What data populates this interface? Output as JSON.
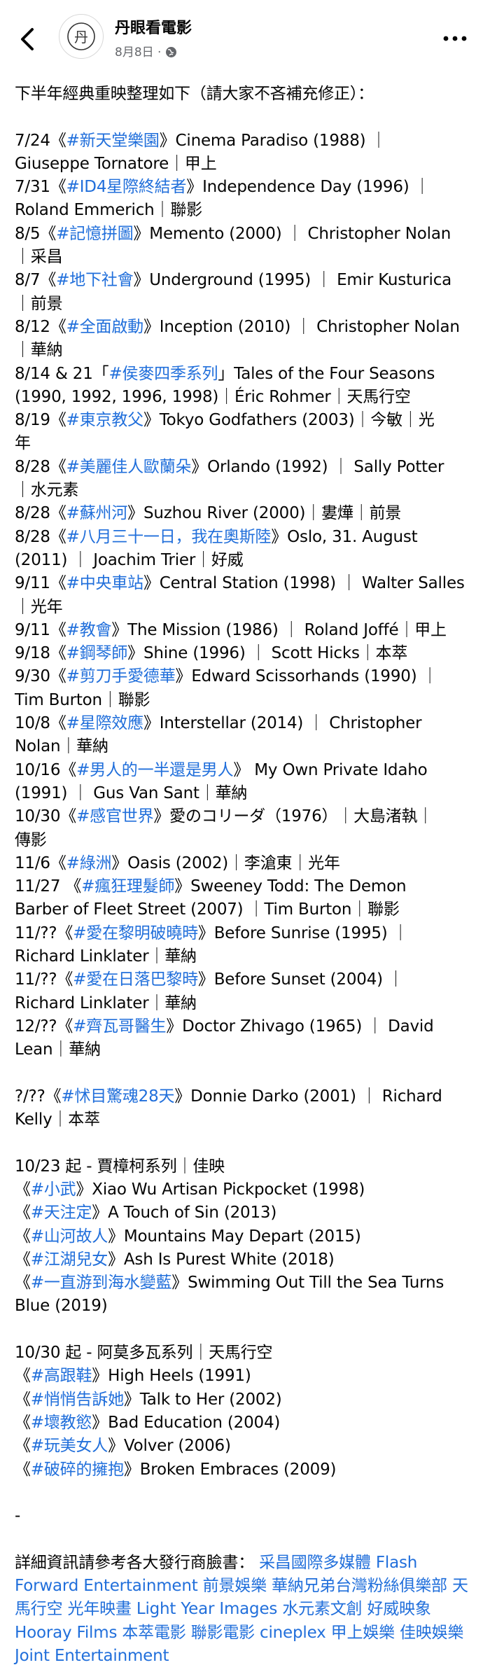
{
  "header": {
    "page_name": "丹眼看電影",
    "avatar_glyph": "丹",
    "date": "8月8日",
    "separator": "·"
  },
  "post": {
    "intro": "下半年經典重映整理如下（請大家不吝補充修正）：",
    "line_1": "7/24《",
    "tag_1": "#新天堂樂園",
    "line_2": "》Cinema Paradiso (1988) ｜\nGiuseppe Tornatore｜甲上\n7/31《",
    "tag_2": "#ID4星際終結者",
    "line_3": "》Independence Day (1996) ｜\nRoland Emmerich｜聯影\n8/5《",
    "tag_3": "#記憶拼圖",
    "line_4": "》Memento (2000) ｜ Christopher Nolan\n｜采昌\n8/7《",
    "tag_4": "#地下社會",
    "line_5": "》Underground (1995) ｜ Emir Kusturica\n｜前景\n8/12《",
    "tag_5": "#全面啟動",
    "line_6": "》Inception (2010) ｜ Christopher Nolan\n｜華納\n8/14 & 21「",
    "tag_6": "#侯麥四季系列",
    "line_7": "」Tales of the Four Seasons\n(1990, 1992, 1996, 1998)｜Éric Rohmer｜天馬行空\n8/19《",
    "tag_7": "#東京教父",
    "line_8": "》Tokyo Godfathers (2003)｜今敏｜光\n年\n8/28《",
    "tag_8": "#美麗佳人歐蘭朵",
    "line_9": "》Orlando (1992) ｜ Sally Potter\n｜水元素\n8/28《",
    "tag_9": "#蘇州河",
    "line_10": "》Suzhou River (2000)｜婁燁｜前景\n8/28《",
    "tag_10": "#八月三十一日，我在奧斯陸",
    "line_11": "》Oslo, 31. August\n(2011) ｜ Joachim Trier｜好威\n9/11《",
    "tag_11": "#中央車站",
    "line_12": "》Central Station (1998) ｜ Walter Salles\n｜光年\n9/11《",
    "tag_12": "#教會",
    "line_13": "》The Mission (1986) ｜ Roland Joffé｜甲上\n9/18《",
    "tag_13": "#鋼琴師",
    "line_14": "》Shine (1996) ｜ Scott Hicks｜本萃\n9/30《",
    "tag_14": "#剪刀手愛德華",
    "line_15": "》Edward Scissorhands (1990) ｜\nTim Burton｜聯影\n10/8《",
    "tag_15": "#星際效應",
    "line_16": "》Interstellar (2014) ｜ Christopher\nNolan｜華納\n10/16《",
    "tag_16": "#男人的一半還是男人",
    "line_17": "》 My Own Private Idaho\n(1991) ｜ Gus Van Sant｜華納\n10/30《",
    "tag_17": "#感官世界",
    "line_18": "》愛のコリーダ（1976）｜大島渚執｜\n傳影\n11/6《",
    "tag_18": "#綠洲",
    "line_19": "》Oasis (2002)｜李滄東｜光年\n11/27 《",
    "tag_19": "#瘋狂理髮師",
    "line_20": "》Sweeney Todd: The Demon\nBarber of Fleet Street (2007) ｜Tim Burton｜聯影\n11/??《",
    "tag_20": "#愛在黎明破曉時",
    "line_21": "》Before Sunrise (1995) ｜\nRichard Linklater｜華納\n11/??《",
    "tag_21": "#愛在日落巴黎時",
    "line_22": "》Before Sunset (2004) ｜\nRichard Linklater｜華納\n12/??《",
    "tag_22": "#齊瓦哥醫生",
    "line_23": "》Doctor Zhivago (1965) ｜ David\nLean｜華納\n\n?/??《",
    "tag_23": "#怵目驚魂28天",
    "line_24": "》Donnie Darko (2001) ｜ Richard\nKelly｜本萃\n\n10/23 起 - 賈樟柯系列｜佳映\n《",
    "tag_24": "#小武",
    "line_25": "》Xiao Wu Artisan Pickpocket (1998)\n《",
    "tag_25": "#天注定",
    "line_26": "》A Touch of Sin (2013)\n《",
    "tag_26": "#山河故人",
    "line_27": "》Mountains May Depart (2015)\n《",
    "tag_27": "#江湖兒女",
    "line_28": "》Ash Is Purest White (2018)\n《",
    "tag_28": "#一直游到海水變藍",
    "line_29": "》Swimming Out Till the Sea Turns\nBlue (2019)\n\n10/30 起 - 阿莫多瓦系列｜天馬行空\n《",
    "tag_29": "#高跟鞋",
    "line_30": "》High Heels (1991)\n《",
    "tag_30": "#悄悄告訴她",
    "line_31": "》Talk to Her (2002)\n《",
    "tag_31": "#壞教慾",
    "line_32": "》Bad Education (2004)\n《",
    "tag_32": "#玩美女人",
    "line_33": "》Volver (2006)\n《",
    "tag_33": "#破碎的擁抱",
    "line_34": "》Broken Embraces (2009)\n\n-\n\n詳細資訊請參考各大發行商臉書： ",
    "link_1": "采昌國際多媒體",
    "link_2": "Flash Forward Entertainment 前景娛樂",
    "link_3": "華納兄弟台灣粉絲俱樂部",
    "link_4": "天馬行空",
    "link_5": "光年映畫 Light Year Images",
    "link_6": "水元素文創",
    "link_7": "好威映象 Hooray Films",
    "link_8": "本萃電影",
    "link_9": "聯影電影 cineplex",
    "link_10": "甲上娛樂",
    "link_11": "佳映娛樂 Joint Entertainment"
  },
  "colors": {
    "link": "#216fdb",
    "text": "#050505",
    "meta": "#65676b"
  },
  "icons": {
    "back": "chevron-left-icon",
    "privacy": "globe-icon",
    "menu": "more-icon"
  }
}
